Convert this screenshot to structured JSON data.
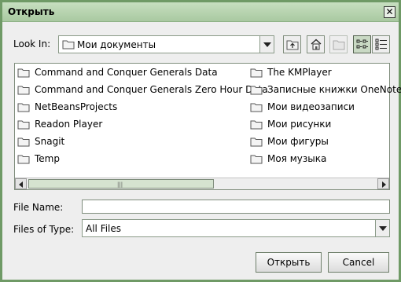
{
  "dialog": {
    "title": "Открыть"
  },
  "look_in": {
    "label": "Look In:",
    "value": "Мои документы",
    "icon": "folder-icon"
  },
  "toolbar": [
    "up-folder-icon",
    "home-icon",
    "new-folder-icon",
    "list-view-icon",
    "details-view-icon"
  ],
  "files": {
    "column1": [
      "Command and Conquer Generals Data",
      "Command and Conquer Generals Zero Hour Data",
      "NetBeansProjects",
      "Readon Player",
      "Snagit",
      "Temp"
    ],
    "column2": [
      "The KMPlayer",
      "Записные книжки OneNote",
      "Мои видеозаписи",
      "Мои рисунки",
      "Мои фигуры",
      "Моя музыка"
    ]
  },
  "file_name": {
    "label": "File Name:",
    "value": ""
  },
  "file_type": {
    "label": "Files of Type:",
    "value": "All Files"
  },
  "buttons": {
    "open": "Открыть",
    "cancel": "Cancel"
  }
}
